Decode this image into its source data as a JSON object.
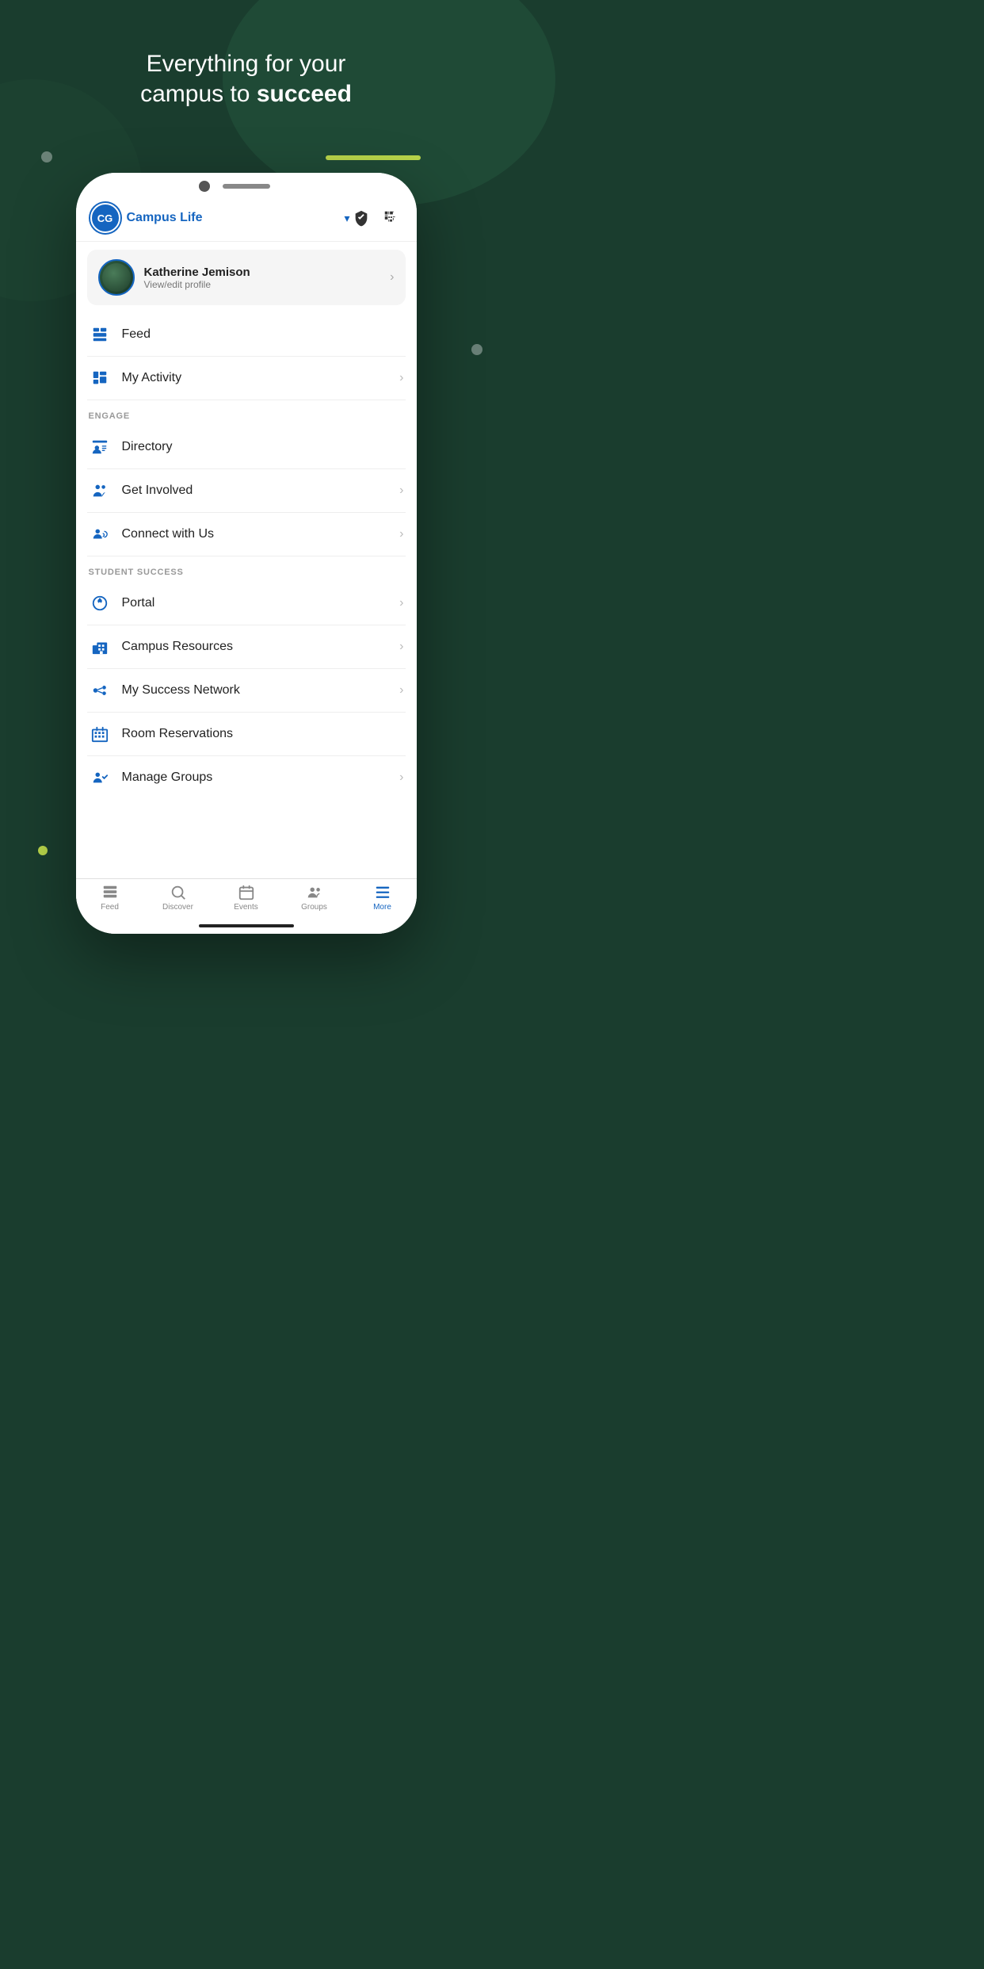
{
  "hero": {
    "line1": "Everything for your",
    "line2": "campus to ",
    "bold": "succeed"
  },
  "app": {
    "logo_initials": "CG",
    "title": "Campus Life",
    "profile": {
      "name": "Katherine Jemison",
      "subtitle": "View/edit profile"
    },
    "menu_items": [
      {
        "id": "feed",
        "label": "Feed",
        "icon": "feed",
        "has_chevron": false,
        "section": null
      },
      {
        "id": "my-activity",
        "label": "My Activity",
        "icon": "activity",
        "has_chevron": true,
        "section": null
      },
      {
        "id": "engage-header",
        "label": "ENGAGE",
        "is_section": true
      },
      {
        "id": "directory",
        "label": "Directory",
        "icon": "directory",
        "has_chevron": false,
        "section": "engage"
      },
      {
        "id": "get-involved",
        "label": "Get Involved",
        "icon": "involved",
        "has_chevron": true,
        "section": "engage"
      },
      {
        "id": "connect",
        "label": "Connect with Us",
        "icon": "connect",
        "has_chevron": true,
        "section": "engage"
      },
      {
        "id": "student-success-header",
        "label": "STUDENT SUCCESS",
        "is_section": true
      },
      {
        "id": "portal",
        "label": "Portal",
        "icon": "portal",
        "has_chevron": true,
        "section": "student-success"
      },
      {
        "id": "campus-resources",
        "label": "Campus Resources",
        "icon": "resources",
        "has_chevron": true,
        "section": "student-success"
      },
      {
        "id": "success-network",
        "label": "My Success Network",
        "icon": "network",
        "has_chevron": true,
        "section": "student-success"
      },
      {
        "id": "room-reservations",
        "label": "Room Reservations",
        "icon": "rooms",
        "has_chevron": false,
        "section": "student-success"
      },
      {
        "id": "manage-groups",
        "label": "Manage Groups",
        "icon": "groups",
        "has_chevron": true,
        "section": "student-success"
      }
    ],
    "bottom_nav": [
      {
        "id": "feed",
        "label": "Feed",
        "icon": "feed",
        "active": false
      },
      {
        "id": "discover",
        "label": "Discover",
        "icon": "discover",
        "active": false
      },
      {
        "id": "events",
        "label": "Events",
        "icon": "events",
        "active": false
      },
      {
        "id": "groups",
        "label": "Groups",
        "icon": "groups",
        "active": false
      },
      {
        "id": "more",
        "label": "More",
        "icon": "more",
        "active": true
      }
    ]
  },
  "colors": {
    "bg": "#1a3d2e",
    "accent": "#b8d44a",
    "primary": "#1565c0",
    "text_dark": "#222222",
    "text_light": "#777777"
  }
}
